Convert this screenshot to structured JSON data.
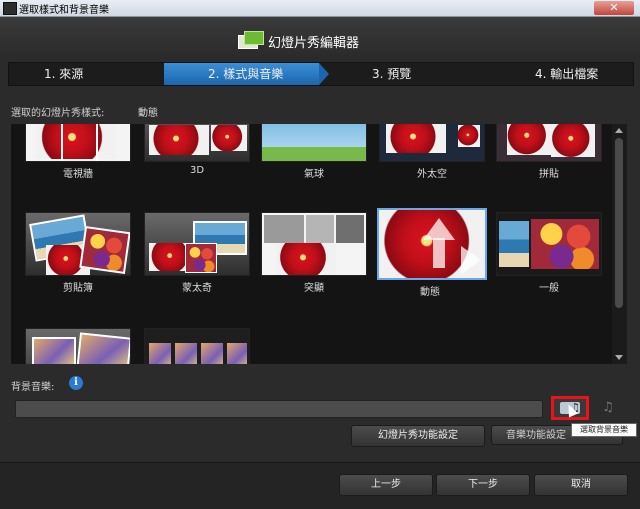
{
  "window": {
    "title": "選取樣式和背景音樂",
    "close_glyph": "✕"
  },
  "header": {
    "app_name": "幻燈片秀編輯器"
  },
  "steps": [
    {
      "label": "1. 來源",
      "active": false
    },
    {
      "label": "2. 樣式與音樂",
      "active": true
    },
    {
      "label": "3. 預覽",
      "active": false
    },
    {
      "label": "4. 輸出檔案",
      "active": false
    }
  ],
  "style_section": {
    "label": "選取的幻燈片秀樣式:",
    "selected_value": "動態"
  },
  "styles": [
    {
      "name": "電視牆",
      "selected": false
    },
    {
      "name": "3D",
      "selected": false
    },
    {
      "name": "氣球",
      "selected": false
    },
    {
      "name": "外太空",
      "selected": false
    },
    {
      "name": "拼貼",
      "selected": false
    },
    {
      "name": "剪貼簿",
      "selected": false
    },
    {
      "name": "蒙太奇",
      "selected": false
    },
    {
      "name": "突顯",
      "selected": false
    },
    {
      "name": "動態",
      "selected": true
    },
    {
      "name": "一般",
      "selected": false
    },
    {
      "name": "",
      "selected": false
    },
    {
      "name": "",
      "selected": false
    }
  ],
  "music_section": {
    "label": "背景音樂:",
    "info_glyph": "i",
    "field_value": "",
    "add_button_glyph": "♫",
    "extra_glyph": "♫",
    "tooltip": "選取背景音樂"
  },
  "buttons": {
    "slideshow_settings": "幻燈片秀功能設定",
    "music_settings": "音樂功能設定",
    "back": "上一步",
    "next": "下一步",
    "cancel": "取消"
  },
  "colors": {
    "accent": "#2a7ad1",
    "highlight": "#e8141b"
  }
}
